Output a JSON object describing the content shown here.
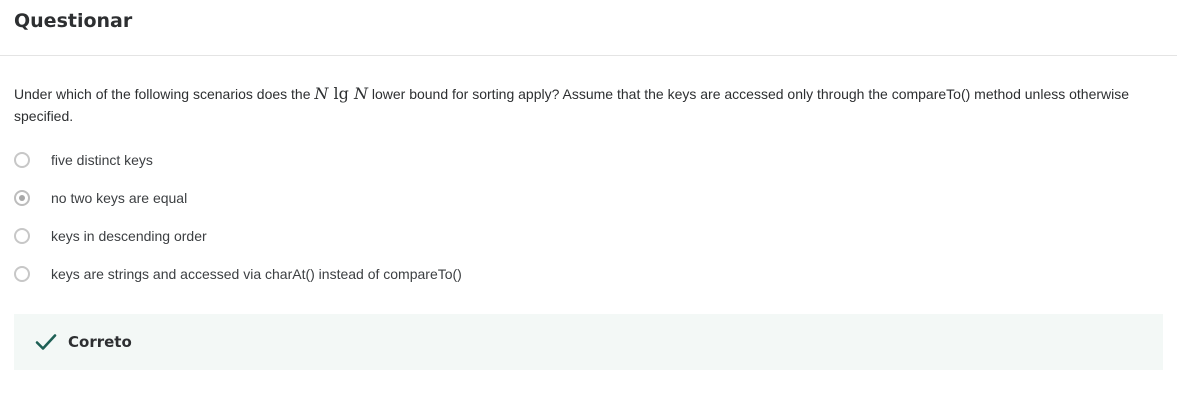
{
  "header": {
    "title": "Questionar"
  },
  "question": {
    "text_before": "Under which of the following scenarios does the ",
    "math_var_1": "N",
    "math_op": "lg",
    "math_var_2": "N",
    "text_after": " lower bound for sorting apply? Assume that the keys are accessed only through the compareTo() method unless otherwise specified."
  },
  "options": [
    {
      "label": "five distinct keys",
      "selected": false
    },
    {
      "label": "no two keys are equal",
      "selected": true
    },
    {
      "label": "keys in descending order",
      "selected": false
    },
    {
      "label": "keys are strings and accessed via charAt() instead of compareTo()",
      "selected": false
    }
  ],
  "feedback": {
    "label": "Correto",
    "icon": "check-icon",
    "color": "#1e6055"
  }
}
